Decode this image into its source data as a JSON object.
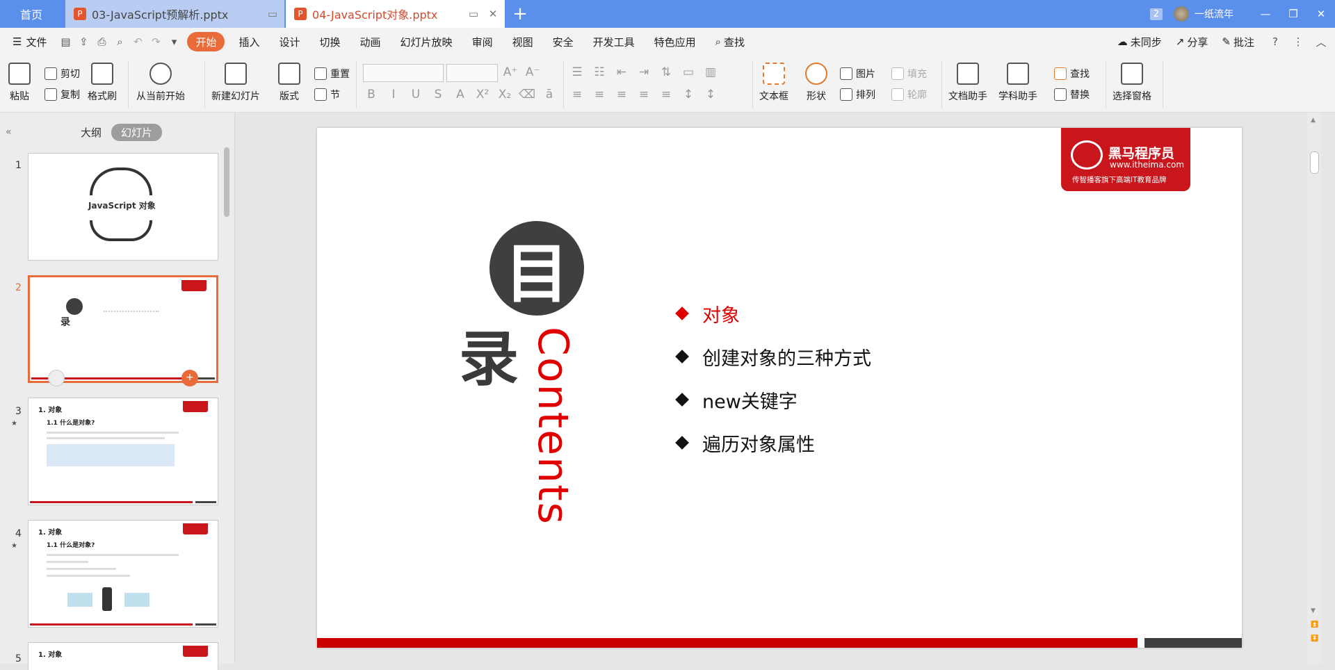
{
  "tabs": {
    "home": "首页",
    "files": [
      {
        "name": "03-JavaScript预解析.pptx",
        "active": false
      },
      {
        "name": "04-JavaScript对象.pptx",
        "active": true
      }
    ],
    "add": "+",
    "window_count": "2",
    "user": "一纸流年"
  },
  "menu": {
    "file": "文件",
    "items": [
      "开始",
      "插入",
      "设计",
      "切换",
      "动画",
      "幻灯片放映",
      "审阅",
      "视图",
      "安全",
      "开发工具",
      "特色应用"
    ],
    "search": "查找",
    "right": [
      "未同步",
      "分享",
      "批注"
    ]
  },
  "ribbon": {
    "paste": "粘贴",
    "cut": "剪切",
    "copy": "复制",
    "format_painter": "格式刷",
    "from_current": "从当前开始",
    "new_slide": "新建幻灯片",
    "layout": "版式",
    "reset": "重置",
    "section": "节",
    "textbox": "文本框",
    "shape": "形状",
    "picture": "图片",
    "fill": "填充",
    "arrange": "排列",
    "outline": "轮廓",
    "doc_assistant": "文档助手",
    "subject_assistant": "学科助手",
    "find": "查找",
    "replace": "替换",
    "selection_pane": "选择窗格"
  },
  "left_panel": {
    "outline_tab": "大纲",
    "slides_tab": "幻灯片",
    "slides": [
      {
        "num": "1",
        "title": "JavaScript 对象"
      },
      {
        "num": "2",
        "title": "录"
      },
      {
        "num": "3",
        "title": "1. 对象",
        "sub": "1.1 什么是对象?"
      },
      {
        "num": "4",
        "title": "1. 对象",
        "sub": "1.1 什么是对象?"
      },
      {
        "num": "5",
        "title": "1. 对象"
      }
    ]
  },
  "slide": {
    "logo_name": "黑马程序员",
    "logo_url": "www.itheima.com",
    "logo_tagline": "传智播客旗下高端IT教育品牌",
    "mu": "目",
    "lu": "录",
    "contents": "Contents",
    "toc": [
      "对象",
      "创建对象的三种方式",
      "new关键字",
      "遍历对象属性"
    ],
    "highlight_color": "#e00000"
  }
}
